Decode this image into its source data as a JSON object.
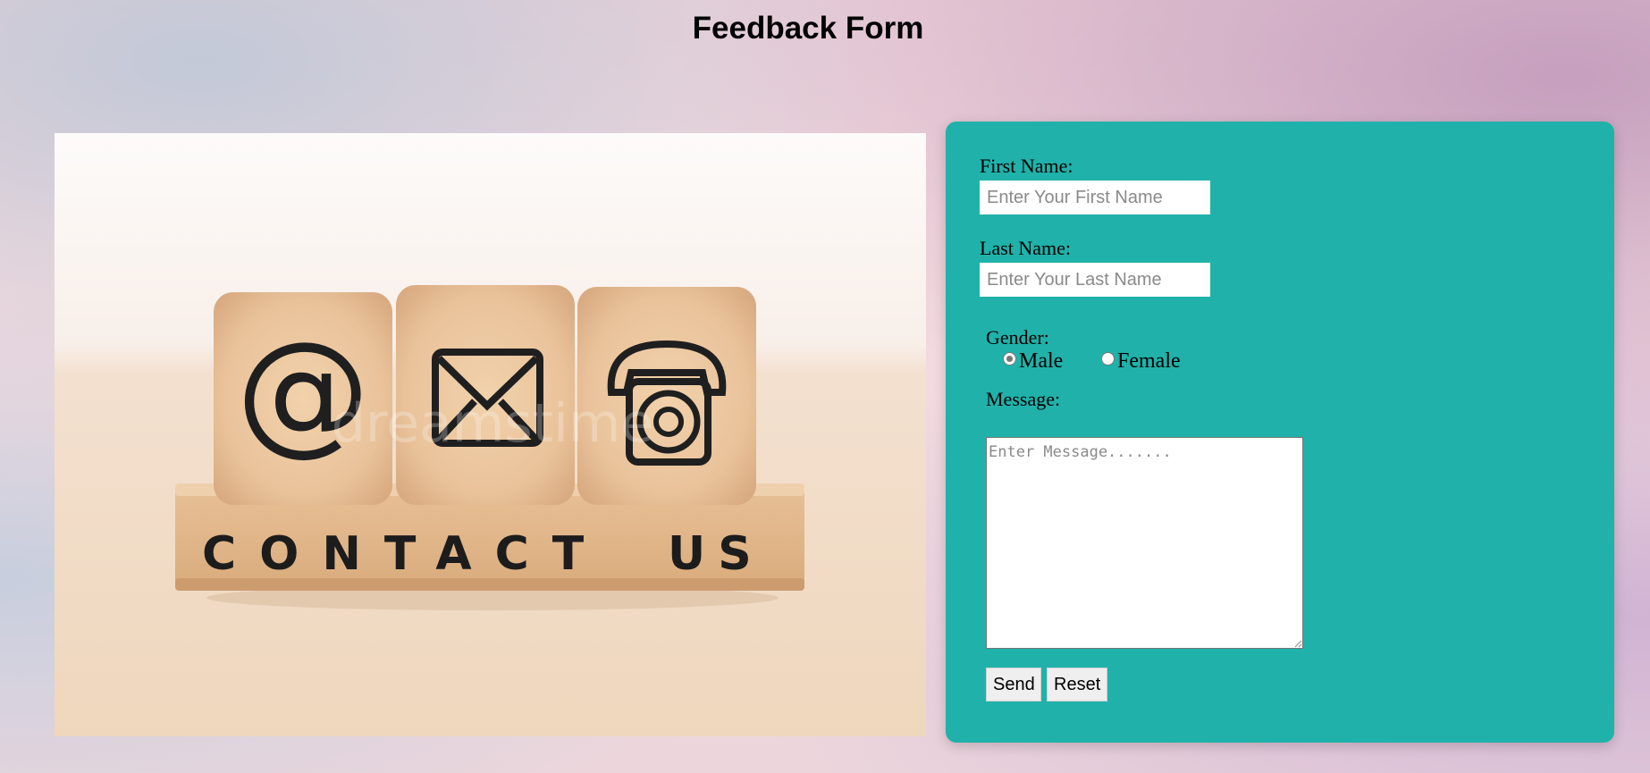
{
  "page": {
    "title": "Feedback Form"
  },
  "image": {
    "blocks": [
      "@",
      "envelope",
      "telephone"
    ],
    "caption": "CONTACT US",
    "watermark": "dreamstime"
  },
  "form": {
    "first_name": {
      "label": "First Name:",
      "placeholder": "Enter Your First Name",
      "value": ""
    },
    "last_name": {
      "label": "Last Name:",
      "placeholder": "Enter Your Last Name",
      "value": ""
    },
    "gender": {
      "label": "Gender:",
      "options": [
        "Male",
        "Female"
      ],
      "selected": "Male"
    },
    "message": {
      "label": "Message:",
      "placeholder": "Enter Message.......",
      "value": ""
    },
    "buttons": {
      "send": "Send",
      "reset": "Reset"
    }
  },
  "colors": {
    "panel": "#20b2aa",
    "title": "#000000"
  }
}
